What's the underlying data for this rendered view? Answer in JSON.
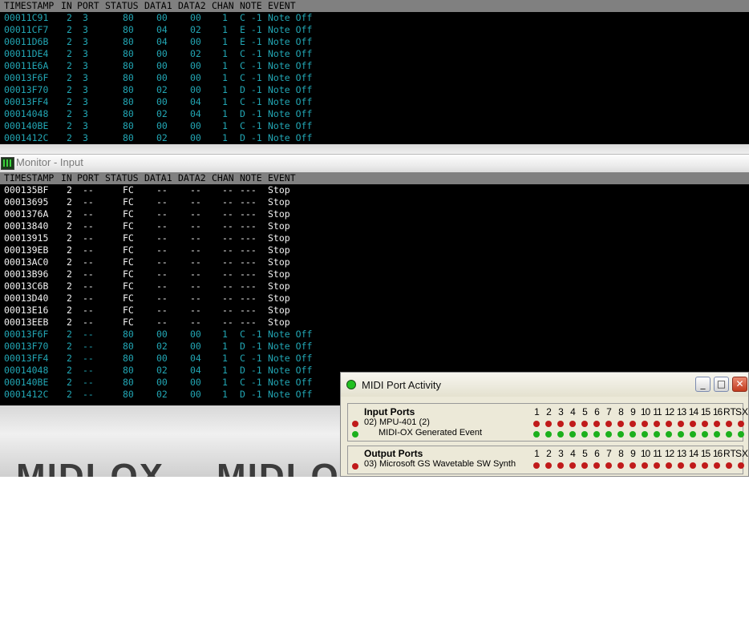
{
  "columns": [
    "TIMESTAMP",
    "IN",
    "PORT",
    "STATUS",
    "DATA1",
    "DATA2",
    "CHAN",
    "NOTE",
    "EVENT"
  ],
  "output_monitor": {
    "rows": [
      [
        "00011C91",
        "2",
        "3",
        "80",
        "00",
        "00",
        "1",
        "C -1",
        "Note Off"
      ],
      [
        "00011CF7",
        "2",
        "3",
        "80",
        "04",
        "02",
        "1",
        "E -1",
        "Note Off"
      ],
      [
        "00011D6B",
        "2",
        "3",
        "80",
        "04",
        "00",
        "1",
        "E -1",
        "Note Off"
      ],
      [
        "00011DE4",
        "2",
        "3",
        "80",
        "00",
        "02",
        "1",
        "C -1",
        "Note Off"
      ],
      [
        "00011E6A",
        "2",
        "3",
        "80",
        "00",
        "00",
        "1",
        "C -1",
        "Note Off"
      ],
      [
        "00013F6F",
        "2",
        "3",
        "80",
        "00",
        "00",
        "1",
        "C -1",
        "Note Off"
      ],
      [
        "00013F70",
        "2",
        "3",
        "80",
        "02",
        "00",
        "1",
        "D -1",
        "Note Off"
      ],
      [
        "00013FF4",
        "2",
        "3",
        "80",
        "00",
        "04",
        "1",
        "C -1",
        "Note Off"
      ],
      [
        "00014048",
        "2",
        "3",
        "80",
        "02",
        "04",
        "1",
        "D -1",
        "Note Off"
      ],
      [
        "000140BE",
        "2",
        "3",
        "80",
        "00",
        "00",
        "1",
        "C -1",
        "Note Off"
      ],
      [
        "0001412C",
        "2",
        "3",
        "80",
        "02",
        "00",
        "1",
        "D -1",
        "Note Off"
      ]
    ]
  },
  "input_monitor": {
    "title": "Monitor - Input",
    "rows": [
      [
        "000135BF",
        "2",
        "--",
        "FC",
        "--",
        "--",
        "--",
        "---",
        "Stop"
      ],
      [
        "00013695",
        "2",
        "--",
        "FC",
        "--",
        "--",
        "--",
        "---",
        "Stop"
      ],
      [
        "0001376A",
        "2",
        "--",
        "FC",
        "--",
        "--",
        "--",
        "---",
        "Stop"
      ],
      [
        "00013840",
        "2",
        "--",
        "FC",
        "--",
        "--",
        "--",
        "---",
        "Stop"
      ],
      [
        "00013915",
        "2",
        "--",
        "FC",
        "--",
        "--",
        "--",
        "---",
        "Stop"
      ],
      [
        "000139EB",
        "2",
        "--",
        "FC",
        "--",
        "--",
        "--",
        "---",
        "Stop"
      ],
      [
        "00013AC0",
        "2",
        "--",
        "FC",
        "--",
        "--",
        "--",
        "---",
        "Stop"
      ],
      [
        "00013B96",
        "2",
        "--",
        "FC",
        "--",
        "--",
        "--",
        "---",
        "Stop"
      ],
      [
        "00013C6B",
        "2",
        "--",
        "FC",
        "--",
        "--",
        "--",
        "---",
        "Stop"
      ],
      [
        "00013D40",
        "2",
        "--",
        "FC",
        "--",
        "--",
        "--",
        "---",
        "Stop"
      ],
      [
        "00013E16",
        "2",
        "--",
        "FC",
        "--",
        "--",
        "--",
        "---",
        "Stop"
      ],
      [
        "00013EEB",
        "2",
        "--",
        "FC",
        "--",
        "--",
        "--",
        "---",
        "Stop"
      ],
      [
        "00013F6F",
        "2",
        "--",
        "80",
        "00",
        "00",
        "1",
        "C -1",
        "Note Off"
      ],
      [
        "00013F70",
        "2",
        "--",
        "80",
        "02",
        "00",
        "1",
        "D -1",
        "Note Off"
      ],
      [
        "00013FF4",
        "2",
        "--",
        "80",
        "00",
        "04",
        "1",
        "C -1",
        "Note Off"
      ],
      [
        "00014048",
        "2",
        "--",
        "80",
        "02",
        "04",
        "1",
        "D -1",
        "Note Off"
      ],
      [
        "000140BE",
        "2",
        "--",
        "80",
        "00",
        "00",
        "1",
        "C -1",
        "Note Off"
      ],
      [
        "0001412C",
        "2",
        "--",
        "80",
        "02",
        "00",
        "1",
        "D -1",
        "Note Off"
      ]
    ]
  },
  "background_logo": [
    "MIDI-OX",
    "MIDI-OX"
  ],
  "port_activity": {
    "title": "MIDI Port Activity",
    "input_header": "Input Ports",
    "output_header": "Output Ports",
    "channel_labels": [
      "1",
      "2",
      "3",
      "4",
      "5",
      "6",
      "7",
      "8",
      "9",
      "10",
      "11",
      "12",
      "13",
      "14",
      "15",
      "16",
      "RT",
      "SX"
    ],
    "input_ports": [
      {
        "name": "02) MPU-401 (2)",
        "led": "red"
      },
      {
        "name": "MIDI-OX Generated Event",
        "led": "green"
      }
    ],
    "output_ports": [
      {
        "name": "03) Microsoft GS Wavetable SW Synth",
        "led": "red"
      }
    ]
  },
  "colors": {
    "note_event": "#22a6b4",
    "system_event": "#f2f2f2",
    "led_red": "#c01a1a",
    "led_green": "#1cb01c"
  }
}
